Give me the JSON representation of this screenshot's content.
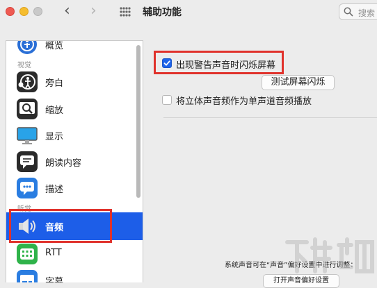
{
  "window": {
    "title": "辅助功能",
    "search_placeholder": "搜索",
    "nav_back_glyph": "‹",
    "nav_forward_glyph": "›"
  },
  "sidebar": {
    "partial_top_label": "概览",
    "sections": [
      {
        "title": "视觉"
      },
      {
        "title": "听觉"
      }
    ],
    "items": [
      {
        "label": "旁白",
        "icon": "voiceover-icon"
      },
      {
        "label": "缩放",
        "icon": "zoom-icon"
      },
      {
        "label": "显示",
        "icon": "display-icon"
      },
      {
        "label": "朗读内容",
        "icon": "spoken-content-icon"
      },
      {
        "label": "描述",
        "icon": "descriptions-icon"
      },
      {
        "label": "音频",
        "icon": "audio-speaker-icon",
        "selected": true
      },
      {
        "label": "RTT",
        "icon": "rtt-icon"
      },
      {
        "label": "字幕",
        "icon": "captions-icon"
      }
    ]
  },
  "content": {
    "flash_screen": {
      "label": "出现警告声音时闪烁屏幕",
      "checked": true
    },
    "test_button_label": "测试屏幕闪烁",
    "mono_audio": {
      "label": "将立体声音频作为单声道音频播放",
      "checked": false
    },
    "footer_note": "系统声音可在“声音”偏好设置中进行调整：",
    "open_prefs_button_label": "打开声音偏好设置"
  },
  "colors": {
    "accent": "#1d5ee8",
    "highlight": "#e0322c"
  }
}
